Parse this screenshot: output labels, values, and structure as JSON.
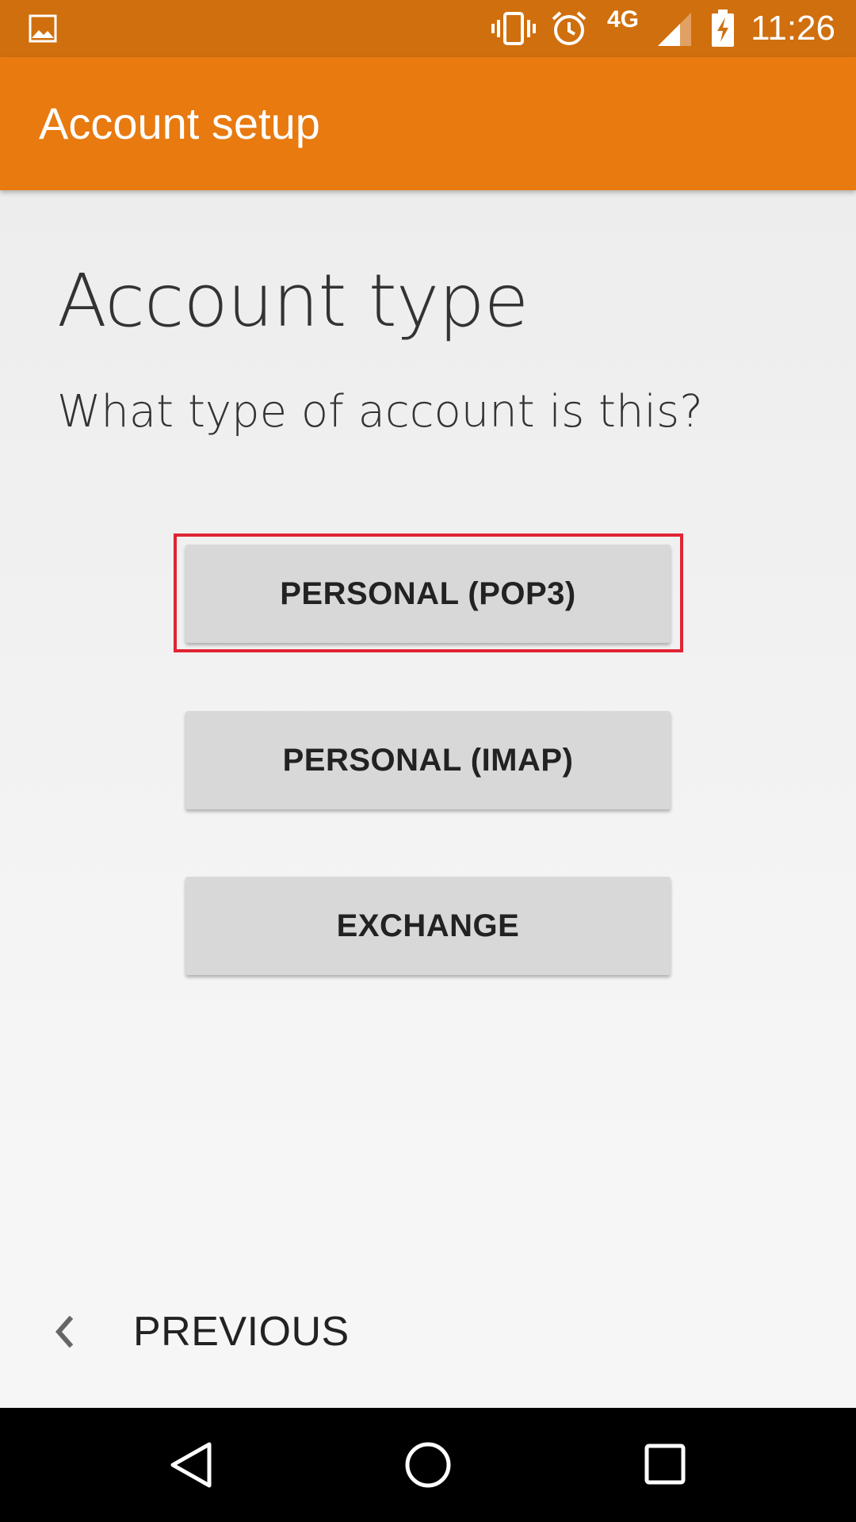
{
  "status_bar": {
    "network": "4G",
    "time": "11:26",
    "icons": [
      "gallery-icon",
      "vibrate-icon",
      "alarm-icon",
      "signal-icon",
      "battery-charging-icon"
    ]
  },
  "app_bar": {
    "title": "Account setup"
  },
  "main": {
    "heading": "Account type",
    "question": "What type of account is this?",
    "options": [
      {
        "label": "PERSONAL (POP3)",
        "highlighted": true
      },
      {
        "label": "PERSONAL (IMAP)",
        "highlighted": false
      },
      {
        "label": "EXCHANGE",
        "highlighted": false
      }
    ]
  },
  "footer": {
    "previous_label": "PREVIOUS"
  },
  "nav_bar": {
    "icons": [
      "back-icon",
      "home-icon",
      "recents-icon"
    ]
  },
  "colors": {
    "status_bar": "#d06f0e",
    "app_bar": "#e87a10",
    "highlight": "#e02533",
    "button_bg": "#d7d8d7"
  }
}
